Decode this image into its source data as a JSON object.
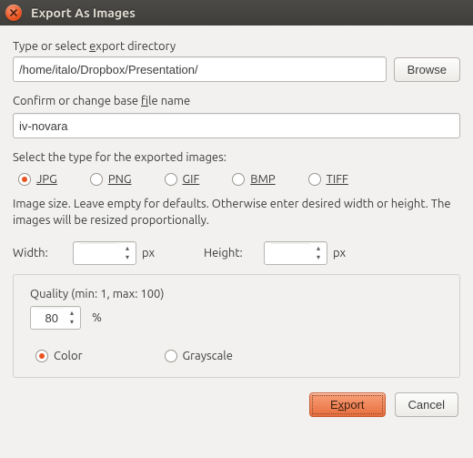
{
  "window": {
    "title": "Export As Images"
  },
  "labels": {
    "directory": "Type or select export directory",
    "basename": "Confirm or change base file name",
    "type_prompt": "Select the type for the exported images:",
    "size_hint": "Image size. Leave empty for defaults. Otherwise enter desired width or height. The images will be resized proportionally.",
    "width": "Width:",
    "height": "Height:",
    "px": "px",
    "quality": "Quality (min: 1, max: 100)",
    "percent": "%"
  },
  "values": {
    "directory": "/home/italo/Dropbox/Presentation/",
    "basename": "iv-novara",
    "quality": "80",
    "width": "",
    "height": ""
  },
  "buttons": {
    "browse": "Browse",
    "export": "Export",
    "cancel": "Cancel"
  },
  "formats": {
    "jpg": "JPG",
    "png": "PNG",
    "gif": "GIF",
    "bmp": "BMP",
    "tiff": "TIFF",
    "selected": "jpg"
  },
  "colormode": {
    "color": "Color",
    "grayscale": "Grayscale",
    "selected": "color"
  }
}
